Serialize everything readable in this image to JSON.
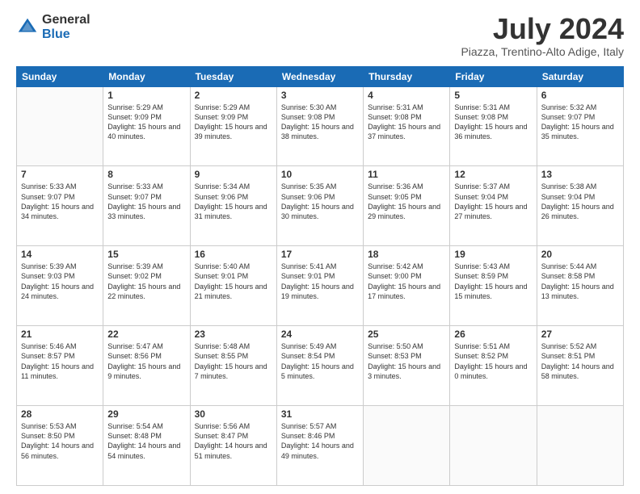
{
  "logo": {
    "general": "General",
    "blue": "Blue"
  },
  "title": {
    "month_year": "July 2024",
    "location": "Piazza, Trentino-Alto Adige, Italy"
  },
  "days_of_week": [
    "Sunday",
    "Monday",
    "Tuesday",
    "Wednesday",
    "Thursday",
    "Friday",
    "Saturday"
  ],
  "weeks": [
    [
      {
        "day": "",
        "sunrise": "",
        "sunset": "",
        "daylight": ""
      },
      {
        "day": "1",
        "sunrise": "5:29 AM",
        "sunset": "9:09 PM",
        "daylight": "15 hours and 40 minutes."
      },
      {
        "day": "2",
        "sunrise": "5:29 AM",
        "sunset": "9:09 PM",
        "daylight": "15 hours and 39 minutes."
      },
      {
        "day": "3",
        "sunrise": "5:30 AM",
        "sunset": "9:08 PM",
        "daylight": "15 hours and 38 minutes."
      },
      {
        "day": "4",
        "sunrise": "5:31 AM",
        "sunset": "9:08 PM",
        "daylight": "15 hours and 37 minutes."
      },
      {
        "day": "5",
        "sunrise": "5:31 AM",
        "sunset": "9:08 PM",
        "daylight": "15 hours and 36 minutes."
      },
      {
        "day": "6",
        "sunrise": "5:32 AM",
        "sunset": "9:07 PM",
        "daylight": "15 hours and 35 minutes."
      }
    ],
    [
      {
        "day": "7",
        "sunrise": "5:33 AM",
        "sunset": "9:07 PM",
        "daylight": "15 hours and 34 minutes."
      },
      {
        "day": "8",
        "sunrise": "5:33 AM",
        "sunset": "9:07 PM",
        "daylight": "15 hours and 33 minutes."
      },
      {
        "day": "9",
        "sunrise": "5:34 AM",
        "sunset": "9:06 PM",
        "daylight": "15 hours and 31 minutes."
      },
      {
        "day": "10",
        "sunrise": "5:35 AM",
        "sunset": "9:06 PM",
        "daylight": "15 hours and 30 minutes."
      },
      {
        "day": "11",
        "sunrise": "5:36 AM",
        "sunset": "9:05 PM",
        "daylight": "15 hours and 29 minutes."
      },
      {
        "day": "12",
        "sunrise": "5:37 AM",
        "sunset": "9:04 PM",
        "daylight": "15 hours and 27 minutes."
      },
      {
        "day": "13",
        "sunrise": "5:38 AM",
        "sunset": "9:04 PM",
        "daylight": "15 hours and 26 minutes."
      }
    ],
    [
      {
        "day": "14",
        "sunrise": "5:39 AM",
        "sunset": "9:03 PM",
        "daylight": "15 hours and 24 minutes."
      },
      {
        "day": "15",
        "sunrise": "5:39 AM",
        "sunset": "9:02 PM",
        "daylight": "15 hours and 22 minutes."
      },
      {
        "day": "16",
        "sunrise": "5:40 AM",
        "sunset": "9:01 PM",
        "daylight": "15 hours and 21 minutes."
      },
      {
        "day": "17",
        "sunrise": "5:41 AM",
        "sunset": "9:01 PM",
        "daylight": "15 hours and 19 minutes."
      },
      {
        "day": "18",
        "sunrise": "5:42 AM",
        "sunset": "9:00 PM",
        "daylight": "15 hours and 17 minutes."
      },
      {
        "day": "19",
        "sunrise": "5:43 AM",
        "sunset": "8:59 PM",
        "daylight": "15 hours and 15 minutes."
      },
      {
        "day": "20",
        "sunrise": "5:44 AM",
        "sunset": "8:58 PM",
        "daylight": "15 hours and 13 minutes."
      }
    ],
    [
      {
        "day": "21",
        "sunrise": "5:46 AM",
        "sunset": "8:57 PM",
        "daylight": "15 hours and 11 minutes."
      },
      {
        "day": "22",
        "sunrise": "5:47 AM",
        "sunset": "8:56 PM",
        "daylight": "15 hours and 9 minutes."
      },
      {
        "day": "23",
        "sunrise": "5:48 AM",
        "sunset": "8:55 PM",
        "daylight": "15 hours and 7 minutes."
      },
      {
        "day": "24",
        "sunrise": "5:49 AM",
        "sunset": "8:54 PM",
        "daylight": "15 hours and 5 minutes."
      },
      {
        "day": "25",
        "sunrise": "5:50 AM",
        "sunset": "8:53 PM",
        "daylight": "15 hours and 3 minutes."
      },
      {
        "day": "26",
        "sunrise": "5:51 AM",
        "sunset": "8:52 PM",
        "daylight": "15 hours and 0 minutes."
      },
      {
        "day": "27",
        "sunrise": "5:52 AM",
        "sunset": "8:51 PM",
        "daylight": "14 hours and 58 minutes."
      }
    ],
    [
      {
        "day": "28",
        "sunrise": "5:53 AM",
        "sunset": "8:50 PM",
        "daylight": "14 hours and 56 minutes."
      },
      {
        "day": "29",
        "sunrise": "5:54 AM",
        "sunset": "8:48 PM",
        "daylight": "14 hours and 54 minutes."
      },
      {
        "day": "30",
        "sunrise": "5:56 AM",
        "sunset": "8:47 PM",
        "daylight": "14 hours and 51 minutes."
      },
      {
        "day": "31",
        "sunrise": "5:57 AM",
        "sunset": "8:46 PM",
        "daylight": "14 hours and 49 minutes."
      },
      {
        "day": "",
        "sunrise": "",
        "sunset": "",
        "daylight": ""
      },
      {
        "day": "",
        "sunrise": "",
        "sunset": "",
        "daylight": ""
      },
      {
        "day": "",
        "sunrise": "",
        "sunset": "",
        "daylight": ""
      }
    ]
  ]
}
